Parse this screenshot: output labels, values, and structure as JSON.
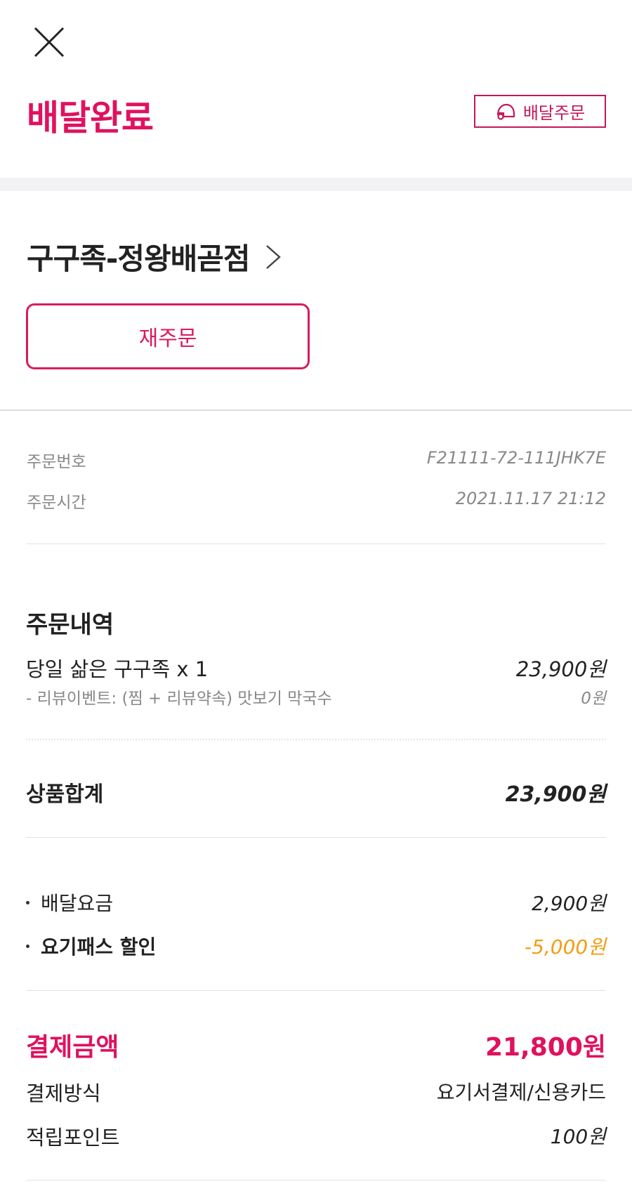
{
  "header": {
    "status_title": "배달완료",
    "delivery_badge_label": "배달주문",
    "colors": {
      "accent": "#e0115f",
      "badge": "#c2185b",
      "discount": "#f39c12"
    }
  },
  "store": {
    "name": "구구족-정왕배곧점",
    "reorder_label": "재주문"
  },
  "order_meta": {
    "order_number_label": "주문번호",
    "order_number_value": "F21111-72-111JHK7E",
    "order_time_label": "주문시간",
    "order_time_value": "2021.11.17 21:12"
  },
  "order_details": {
    "title": "주문내역",
    "items": [
      {
        "name": "당일 삶은 구구족 x 1",
        "price": "23,900원",
        "option_name": "- 리뷰이벤트:  (찜 + 리뷰약속) 맛보기 막국수",
        "option_price": "0원"
      }
    ]
  },
  "subtotal": {
    "label": "상품합계",
    "value": "23,900원"
  },
  "fees": [
    {
      "label": "배달요금",
      "value": "2,900원"
    },
    {
      "label": "요기패스 할인",
      "value": "-5,000원"
    }
  ],
  "payment": {
    "total_label": "결제금액",
    "total_value": "21,800원",
    "method_label": "결제방식",
    "method_value": "요기서결제/신용카드",
    "points_label": "적립포인트",
    "points_value": "100원"
  },
  "icons": {
    "close": "close-icon",
    "delivery": "helmet-icon",
    "store_chevron": "chevron-right-icon"
  }
}
